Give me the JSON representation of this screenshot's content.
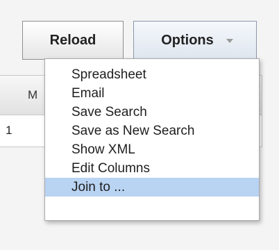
{
  "toolbar": {
    "reload_label": "Reload",
    "options_label": "Options"
  },
  "table": {
    "header_visible_text": "M",
    "first_row_value": "1"
  },
  "menu": {
    "items": [
      {
        "label": "Spreadsheet"
      },
      {
        "label": "Email"
      },
      {
        "label": "Save Search"
      },
      {
        "label": "Save as New Search"
      },
      {
        "label": "Show XML"
      },
      {
        "label": "Edit Columns"
      },
      {
        "label": "Join to ..."
      }
    ],
    "selected_item": "Join to ..."
  },
  "colors": {
    "selected_highlight": "#b9d3f3",
    "options_button_accent": "#8a96aa"
  },
  "icons": {
    "options_dropdown": "chevron-down-icon"
  }
}
